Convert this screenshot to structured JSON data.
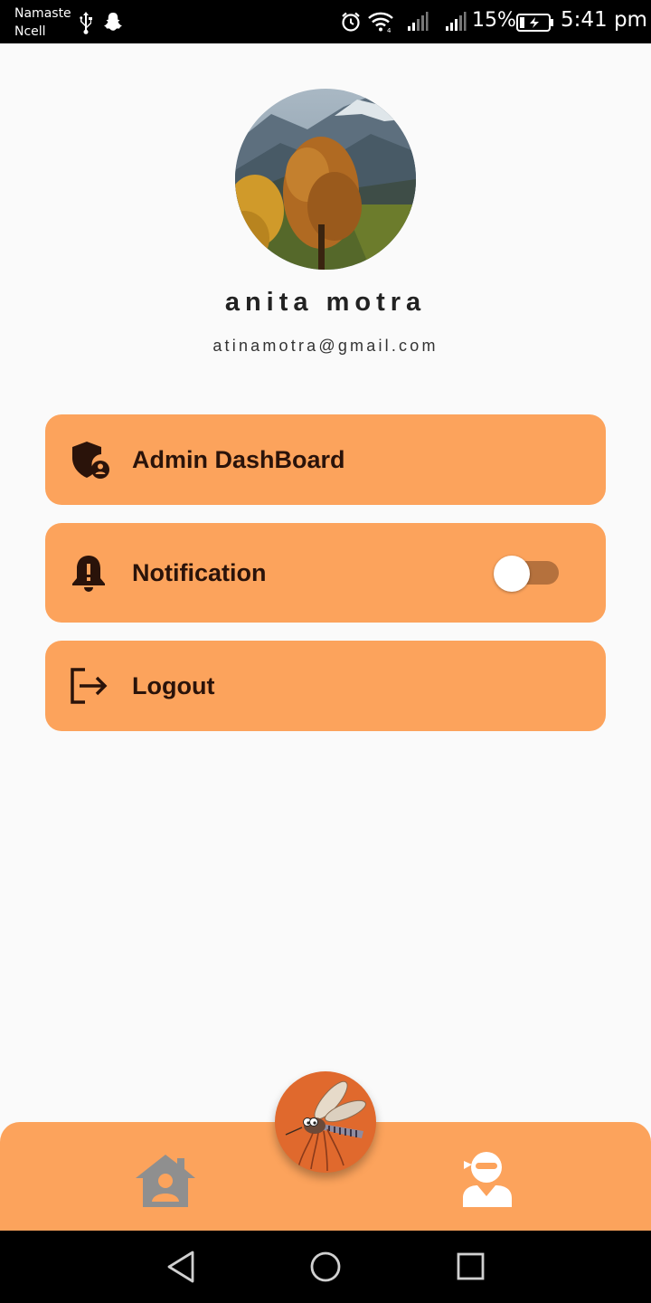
{
  "status_bar": {
    "carrier_line1": "Namaste",
    "carrier_line2": "Ncell",
    "battery": "15%",
    "time": "5:41 pm",
    "icons": [
      "usb-icon",
      "snapchat-icon",
      "alarm-icon",
      "wifi-icon",
      "signal-icon",
      "signal-icon",
      "battery-charging-icon"
    ]
  },
  "profile": {
    "name": "anita motra",
    "email": "atinamotra@gmail.com"
  },
  "menu": {
    "admin": {
      "label": "Admin DashBoard",
      "icon": "admin-shield-icon"
    },
    "notification": {
      "label": "Notification",
      "icon": "bell-alert-icon",
      "toggle_on": false
    },
    "logout": {
      "label": "Logout",
      "icon": "logout-icon"
    }
  },
  "bottom_nav": {
    "items": [
      {
        "icon": "home-person-icon",
        "active": false
      },
      {
        "icon": "user-ninja-icon",
        "active": true
      }
    ],
    "fab_icon": "mosquito-icon"
  },
  "system_nav": {
    "icons": [
      "back-icon",
      "home-circle-icon",
      "recents-icon"
    ]
  },
  "colors": {
    "card": "#fca35c",
    "fab": "#e0692d",
    "text_dark": "#2a130a",
    "toggle_track": "#b5713d",
    "nav_inactive": "#8f8f8f",
    "nav_active": "#ffffff"
  }
}
